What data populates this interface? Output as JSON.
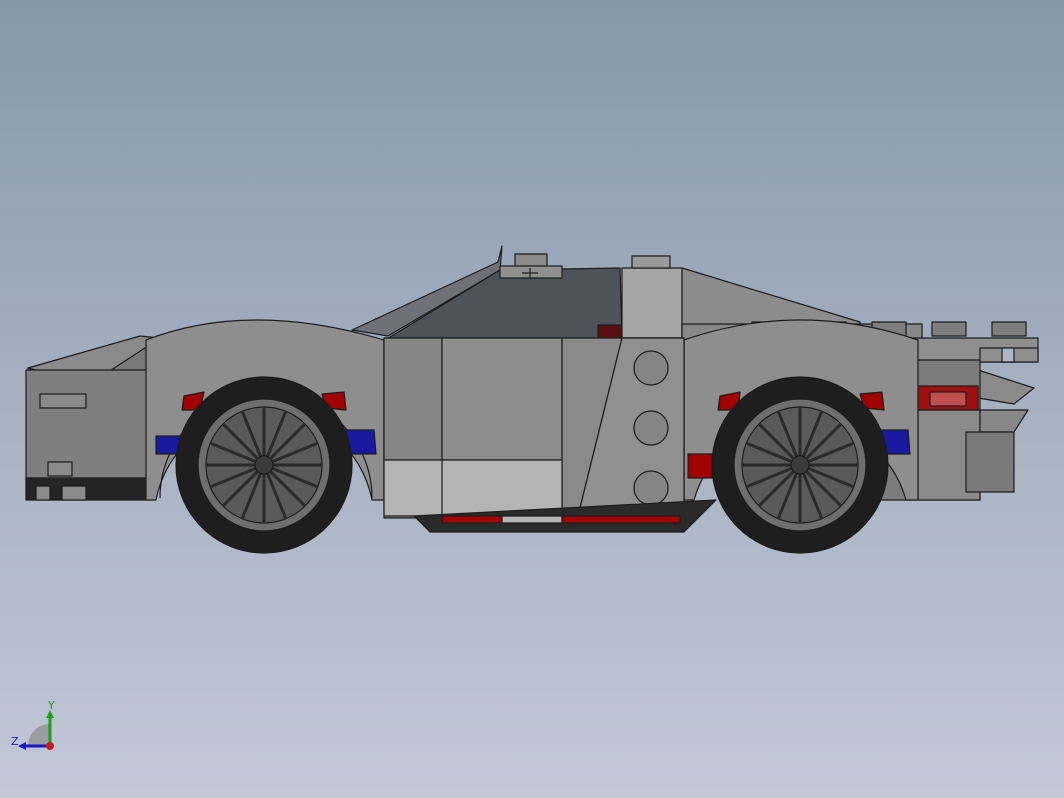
{
  "viewport": {
    "background_top": "#8697aa",
    "background_bottom": "#c2c8d6"
  },
  "model": {
    "name": "car-model",
    "body_color": "#8c8c8c",
    "accent_red": "#a00000",
    "accent_blue": "#1a1aa0",
    "tire_color": "#1e1e1e",
    "rim_color": "#6e6e6e"
  },
  "triad": {
    "y_label": "Y",
    "z_label": "Z",
    "y_color": "#1aa01a",
    "z_color": "#1a1ac8",
    "x_color": "#c81a1a"
  }
}
